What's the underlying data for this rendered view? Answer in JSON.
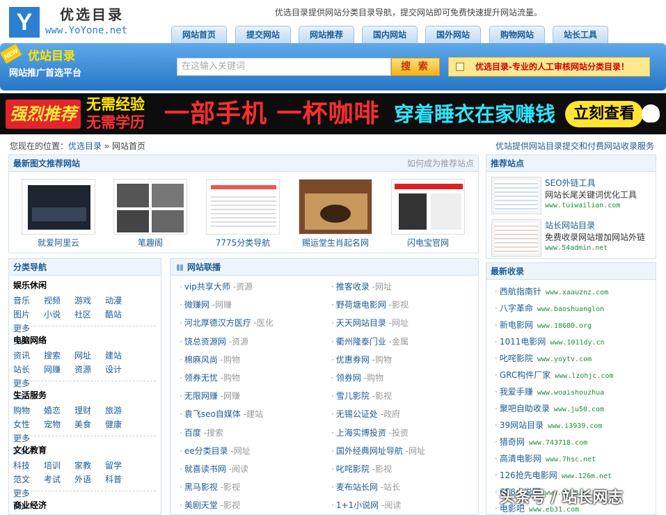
{
  "header": {
    "logo_letter": "Y",
    "logo_cn": "优选目录",
    "logo_en": "www.YoYone.net",
    "slogan": "优选目录提供网站分类目录导航，提交网站即可免费快速提升网站流量。",
    "nav": [
      "网站首页",
      "提交网站",
      "网站推荐",
      "国内网站",
      "国外网站",
      "购物网站",
      "站长工具"
    ]
  },
  "band": {
    "new_tag": "NEW",
    "title": "优站目录",
    "subtitle": "网站推广首选平台",
    "search_placeholder": "在这输入关键词",
    "search_button": "搜 索",
    "notice": "优选目录-专业的人工审核网站分类目录！"
  },
  "ad_banner": {
    "tag": "强烈推荐",
    "line1": "无需经验",
    "line2": "无需学历",
    "main": "一部手机 一杯咖啡",
    "cta_text": "穿着睡衣在家赚钱",
    "button": "立刻查看"
  },
  "breadcrumb": {
    "prefix": "您现在的位置：",
    "home": "优选目录",
    "sep": "»",
    "current": "网站首页",
    "right_text": "优站提供网站目录提交和付费网站收录服务"
  },
  "featured": {
    "title": "最新图文推荐网站",
    "more": "如何成为推荐站点",
    "items": [
      "就爱阿里云",
      "笔趣阁",
      "7775分类导航",
      "赐运堂生肖起名网",
      "闪电宝官网"
    ]
  },
  "categories": {
    "title": "分类导航",
    "groups": [
      {
        "name": "娱乐休闲",
        "links": [
          "音乐",
          "视频",
          "游戏",
          "动漫",
          "图片",
          "小说",
          "社区",
          "酷站",
          "更多>>"
        ]
      },
      {
        "name": "电脑网络",
        "links": [
          "资讯",
          "搜索",
          "网址",
          "建站",
          "站长",
          "网赚",
          "资源",
          "设计",
          "更多>>"
        ]
      },
      {
        "name": "生活服务",
        "links": [
          "购物",
          "婚恋",
          "理财",
          "旅游",
          "女性",
          "宠物",
          "美食",
          "健康",
          "更多>>"
        ]
      },
      {
        "name": "文化教育",
        "links": [
          "科技",
          "培训",
          "家教",
          "留学",
          "范文",
          "考试",
          "外语",
          "科普",
          "更多>>"
        ]
      },
      {
        "name": "商业经济",
        "links": []
      }
    ]
  },
  "alliance": {
    "title": "网站联播",
    "left": [
      {
        "name": "vip共享大师",
        "tag": "-资源"
      },
      {
        "name": "微赚网",
        "tag": "-网赚"
      },
      {
        "name": "河北厚德汉方医疗",
        "tag": "-医化"
      },
      {
        "name": "饶总资源网",
        "tag": "-资源"
      },
      {
        "name": "棉麻风尚",
        "tag": "-购物"
      },
      {
        "name": "领券无忧",
        "tag": "-购物"
      },
      {
        "name": "无限网赚",
        "tag": "-网赚"
      },
      {
        "name": "袁飞seo自媒体",
        "tag": "-建站"
      },
      {
        "name": "百度",
        "tag": "-搜索"
      },
      {
        "name": "ee分类目录",
        "tag": "-网址"
      },
      {
        "name": "就喜读书网",
        "tag": "-阅读"
      },
      {
        "name": "黑马影视",
        "tag": "-影视"
      },
      {
        "name": "美剧天堂",
        "tag": "-影视"
      }
    ],
    "right": [
      {
        "name": "推客收录",
        "tag": "-网址"
      },
      {
        "name": "野荷塘电影网",
        "tag": "-影视"
      },
      {
        "name": "天天网站目录",
        "tag": "-网址"
      },
      {
        "name": "衢州隆泰门业",
        "tag": "-金属"
      },
      {
        "name": "优惠券网",
        "tag": "-购物"
      },
      {
        "name": "领券网",
        "tag": "-购物"
      },
      {
        "name": "雪儿影院",
        "tag": "-影视"
      },
      {
        "name": "无锡公证处",
        "tag": "-政府"
      },
      {
        "name": "上海实博投资",
        "tag": "-投资"
      },
      {
        "name": "国外经典网址导航",
        "tag": "-网址"
      },
      {
        "name": "叱咤影院",
        "tag": "-影视"
      },
      {
        "name": "麦布站长网",
        "tag": "-站长"
      },
      {
        "name": "1+1小说网",
        "tag": "-阅读"
      }
    ]
  },
  "recommended": {
    "title": "推荐站点",
    "items": [
      {
        "name": "SEO外链工具",
        "desc": "网站长尾关键词优化工具",
        "url": "www.tuiwailian.com"
      },
      {
        "name": "站长网站目录",
        "desc": "免费收录网站增加网站外链",
        "url": "www.54admin.net"
      }
    ]
  },
  "latest": {
    "title": "最新收录",
    "items": [
      {
        "name": "西航指南针",
        "url": "www.xaauznz.com"
      },
      {
        "name": "八字革命",
        "url": "www.baoshuanglon"
      },
      {
        "name": "新电影网",
        "url": "www.18600.org"
      },
      {
        "name": "1011电影网",
        "url": "www.1011dy.cn"
      },
      {
        "name": "叱咤影院",
        "url": "www.yoytv.com"
      },
      {
        "name": "GRC构件厂家",
        "url": "www.lzohjc.com"
      },
      {
        "name": "我爱手赚",
        "url": "www.woaishouzhua"
      },
      {
        "name": "聚吧自助收录",
        "url": "www.ju50.com"
      },
      {
        "name": "39网站目录",
        "url": "www.i3939.com"
      },
      {
        "name": "猎奇网",
        "url": "www.743718.com"
      },
      {
        "name": "高清电影网",
        "url": "www.7hsc.net"
      },
      {
        "name": "126抢先电影网",
        "url": "www.126m.net"
      },
      {
        "name": "658小说网",
        "url": "www.i658.cc"
      },
      {
        "name": "电影吧",
        "url": "www.eb31.com"
      }
    ]
  },
  "watermark": "头条号 / 站长网志"
}
